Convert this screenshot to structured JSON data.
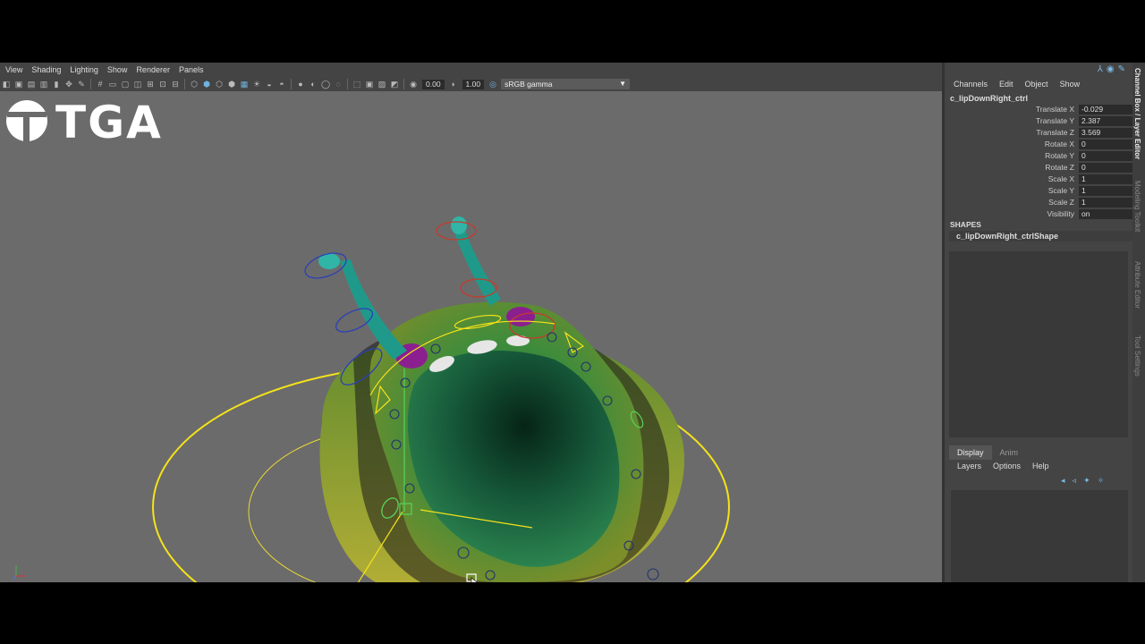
{
  "viewport": {
    "menu": [
      "View",
      "Shading",
      "Lighting",
      "Show",
      "Renderer",
      "Panels"
    ],
    "toolbar": {
      "exposure": "0.00",
      "gamma": "1.00",
      "color_space": "sRGB gamma"
    },
    "logo_text": "TGA"
  },
  "channel_box": {
    "menu": [
      "Channels",
      "Edit",
      "Object",
      "Show"
    ],
    "node_name": "c_lipDownRight_ctrl",
    "attributes": [
      {
        "label": "Translate X",
        "value": "-0.029"
      },
      {
        "label": "Translate Y",
        "value": "2.387"
      },
      {
        "label": "Translate Z",
        "value": "3.569"
      },
      {
        "label": "Rotate X",
        "value": "0"
      },
      {
        "label": "Rotate Y",
        "value": "0"
      },
      {
        "label": "Rotate Z",
        "value": "0"
      },
      {
        "label": "Scale X",
        "value": "1"
      },
      {
        "label": "Scale Y",
        "value": "1"
      },
      {
        "label": "Scale Z",
        "value": "1"
      },
      {
        "label": "Visibility",
        "value": "on"
      }
    ],
    "shapes_heading": "SHAPES",
    "shape_name": "c_lipDownRight_ctrlShape"
  },
  "layer_editor": {
    "tabs": [
      "Display",
      "Anim"
    ],
    "menu": [
      "Layers",
      "Options",
      "Help"
    ]
  },
  "side_tabs": [
    "Channel Box / Layer Editor",
    "Modeling Toolkit",
    "Attribute Editor",
    "Tool Settings"
  ],
  "colors": {
    "accent_blue": "#6fb3e0",
    "viewport_bg": "#6b6b6b",
    "panel_bg": "#444444",
    "nurbs_yellow": "#f4e21a"
  }
}
